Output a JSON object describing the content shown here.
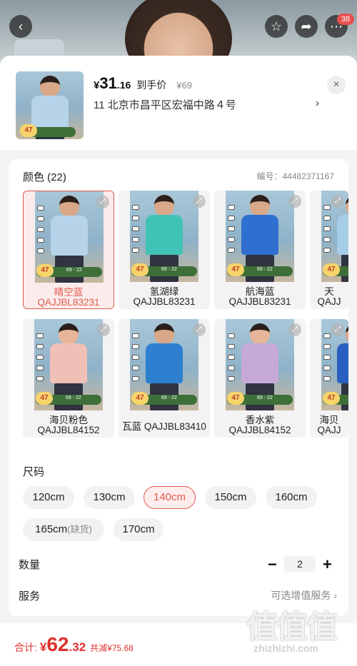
{
  "top_bar": {
    "back_icon": "chevron-left-icon",
    "favorite_icon": "star-icon",
    "share_icon": "share-icon",
    "more_icon": "more-icon",
    "notification_count": "38"
  },
  "header": {
    "price_symbol": "¥",
    "price_int": "31",
    "price_dec": ".16",
    "price_tag": "到手价",
    "original_price": "¥69",
    "address": "11  北京市昌平区宏福中路４号",
    "address_arrow": "›",
    "close_label": "×"
  },
  "color": {
    "title": "颜色 (22)",
    "code": "编号：44482371167",
    "variants": [
      {
        "name": "晴空蓝",
        "sku": "QAJJBL83231",
        "shirt": "#b6d3ea",
        "selected": true
      },
      {
        "name": "氢湖绿",
        "sku": "QAJJBL83231",
        "shirt": "#3fc3b6",
        "selected": false
      },
      {
        "name": "航海蓝",
        "sku": "QAJJBL83231",
        "shirt": "#2f6fcf",
        "selected": false
      },
      {
        "name": "天",
        "sku": "QAJJ",
        "shirt": "#a6cde8",
        "selected": false
      },
      {
        "name": "海贝粉色",
        "sku": "QAJJBL84152",
        "shirt": "#f0c0b6",
        "selected": false
      },
      {
        "name": "瓦蓝 QAJJBL83410",
        "sku": "",
        "shirt": "#2d7fd0",
        "selected": false
      },
      {
        "name": "香水紫",
        "sku": "QAJJBL84152",
        "shirt": "#c7a9d6",
        "selected": false
      },
      {
        "name": "海贝",
        "sku": "QAJJ",
        "shirt": "#2a5fbf",
        "selected": false
      }
    ],
    "promo_badge": "47",
    "promo_text": "69 - 22"
  },
  "size": {
    "title": "尺码",
    "options": [
      {
        "label": "120cm",
        "note": "",
        "active": false
      },
      {
        "label": "130cm",
        "note": "",
        "active": false
      },
      {
        "label": "140cm",
        "note": "",
        "active": true
      },
      {
        "label": "150cm",
        "note": "",
        "active": false
      },
      {
        "label": "160cm",
        "note": "",
        "active": false
      },
      {
        "label": "165cm",
        "note": "(缺货)",
        "active": false
      },
      {
        "label": "170cm",
        "note": "",
        "active": false
      }
    ]
  },
  "quantity": {
    "title": "数量",
    "minus": "−",
    "value": "2",
    "plus": "+"
  },
  "service": {
    "title": "服务",
    "hint": "可选增值服务 ›"
  },
  "footer": {
    "label": "合计:",
    "symbol": "¥",
    "total_int": "62",
    "total_dec": ".32",
    "saved": "共减¥75.68"
  },
  "watermark": {
    "big": "值值值",
    "small": "zhizhizhi.com"
  },
  "accent": "#e35b4f"
}
